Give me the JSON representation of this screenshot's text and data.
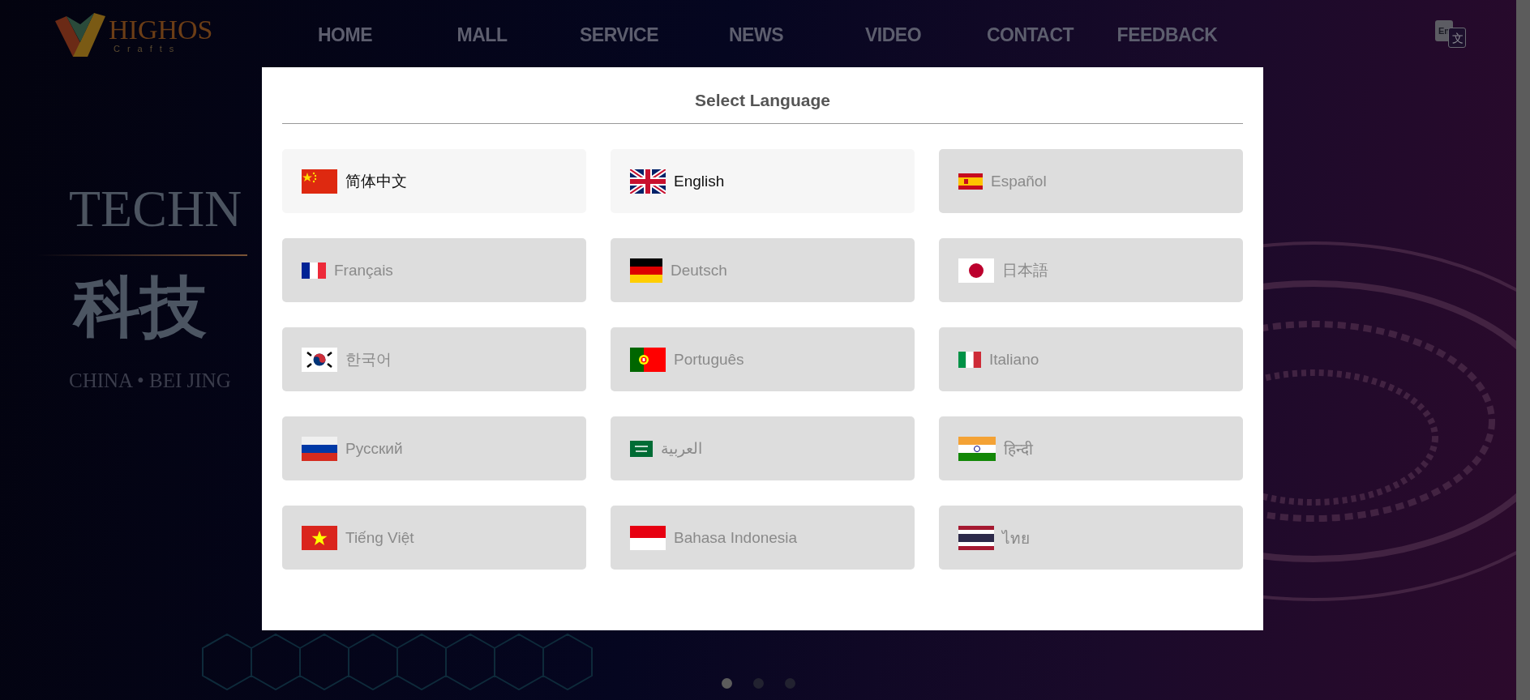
{
  "header": {
    "logo": {
      "name": "HIGHOS",
      "tagline": "Crafts"
    },
    "nav": [
      {
        "label": "HOME"
      },
      {
        "label": "MALL"
      },
      {
        "label": "SERVICE"
      },
      {
        "label": "NEWS"
      },
      {
        "label": "VIDEO"
      },
      {
        "label": "CONTACT"
      },
      {
        "label": "FEEDBACK"
      }
    ],
    "language_button": {
      "label": "En",
      "glyph": "文"
    }
  },
  "hero": {
    "title": "TECHN",
    "heading": "科技",
    "subtitle": "CHINA • BEI JING"
  },
  "carousel_dots": [
    {
      "selected": true
    },
    {
      "selected": false
    },
    {
      "selected": false
    }
  ],
  "language_dialog": {
    "title": "Select Language",
    "languages": [
      {
        "label": "简体中文",
        "disabled": false
      },
      {
        "label": "English",
        "disabled": false
      },
      {
        "label": "Español",
        "disabled": true
      },
      {
        "label": "Français",
        "disabled": true
      },
      {
        "label": "Deutsch",
        "disabled": true
      },
      {
        "label": "日本語",
        "disabled": true
      },
      {
        "label": "한국어",
        "disabled": true
      },
      {
        "label": "Português",
        "disabled": true
      },
      {
        "label": "Italiano",
        "disabled": true
      },
      {
        "label": "Русский",
        "disabled": true
      },
      {
        "label": "العربية",
        "disabled": true
      },
      {
        "label": "हिन्दी",
        "disabled": true
      },
      {
        "label": "Tiếng Việt",
        "disabled": true
      },
      {
        "label": "Bahasa Indonesia",
        "disabled": true
      },
      {
        "label": "ไทย",
        "disabled": true
      }
    ]
  }
}
